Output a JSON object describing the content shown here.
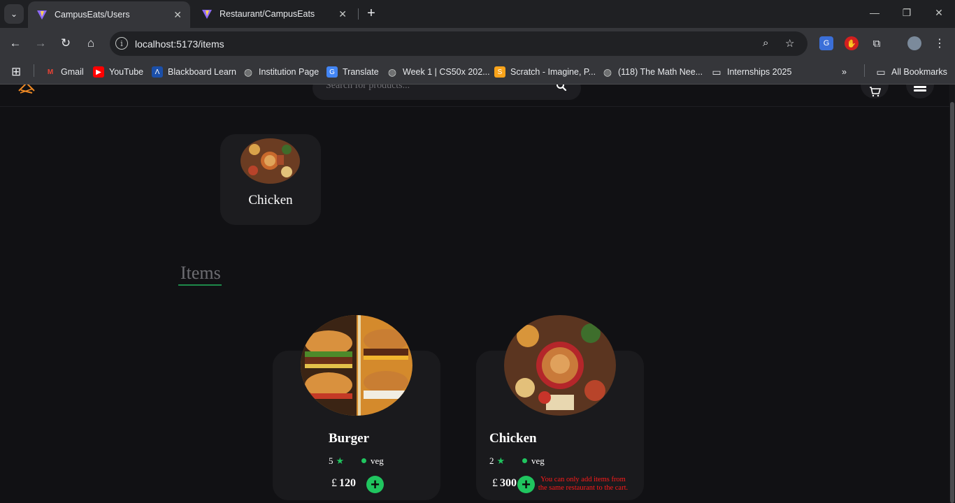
{
  "browser": {
    "tabs": [
      {
        "title": "CampusEats/Users",
        "active": true
      },
      {
        "title": "Restaurant/CampusEats",
        "active": false
      }
    ],
    "url": "localhost:5173/items",
    "bookmarks": [
      {
        "label": "Gmail",
        "icon": "gmail-icon"
      },
      {
        "label": "YouTube",
        "icon": "youtube-icon"
      },
      {
        "label": "Blackboard Learn",
        "icon": "blackboard-icon"
      },
      {
        "label": "Institution Page",
        "icon": "globe-icon"
      },
      {
        "label": "Translate",
        "icon": "translate-icon"
      },
      {
        "label": "Week 1 | CS50x 202...",
        "icon": "globe-icon"
      },
      {
        "label": "Scratch - Imagine, P...",
        "icon": "scratch-icon"
      },
      {
        "label": "(118) The Math Nee...",
        "icon": "globe-icon"
      },
      {
        "label": "Internships 2025",
        "icon": "folder-icon"
      }
    ],
    "all_bookmarks_label": "All Bookmarks"
  },
  "app": {
    "search_placeholder": "Search for products...",
    "categories": [
      {
        "label": "Chicken"
      }
    ],
    "section_title": "Items",
    "items": [
      {
        "name": "Burger",
        "rating": "5",
        "type": "veg",
        "currency": "£",
        "price": "120"
      },
      {
        "name": "Chicken",
        "rating": "2",
        "type": "veg",
        "currency": "£",
        "price": "300"
      }
    ],
    "cart_warning": "You can only add items from the same restaurant to the cart."
  },
  "colors": {
    "background": "#111114",
    "card": "#1a1a1d",
    "accent_green": "#20c55f",
    "warning_red": "#ff1a1a"
  }
}
